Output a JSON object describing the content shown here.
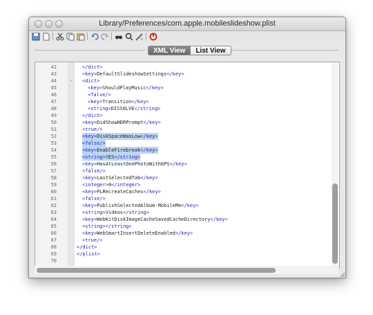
{
  "window": {
    "title": "Library/Preferences/com.apple.mobileslideshow.plist"
  },
  "toolbar": {
    "icons": [
      "save-icon",
      "new-icon",
      "cut-icon",
      "copy-icon",
      "paste-icon",
      "undo-icon",
      "redo-icon",
      "find-icon",
      "find-next-icon",
      "replace-icon",
      "stop-icon"
    ]
  },
  "tabs": {
    "xml": "XML View",
    "list": "List View",
    "selected": "XML View"
  },
  "editor": {
    "fold_marker": "-",
    "lines": [
      {
        "n": "42",
        "indent": 2,
        "parts": [
          [
            "t",
            "</dict>"
          ]
        ]
      },
      {
        "n": "43",
        "indent": 2,
        "parts": [
          [
            "t",
            "<key>"
          ],
          [
            "x",
            "DefaultSlideshowSettings"
          ],
          [
            "t",
            "</key>"
          ]
        ]
      },
      {
        "n": "44",
        "indent": 2,
        "parts": [
          [
            "t",
            "<dict>"
          ]
        ]
      },
      {
        "n": "45",
        "indent": 3,
        "parts": [
          [
            "t",
            "<key>"
          ],
          [
            "x",
            "ShouldPlayMusic"
          ],
          [
            "t",
            "</key>"
          ]
        ]
      },
      {
        "n": "46",
        "indent": 3,
        "parts": [
          [
            "t",
            "<false/>"
          ]
        ]
      },
      {
        "n": "47",
        "indent": 3,
        "parts": [
          [
            "t",
            "<key>"
          ],
          [
            "x",
            "Transition"
          ],
          [
            "t",
            "</key>"
          ]
        ]
      },
      {
        "n": "48",
        "indent": 3,
        "parts": [
          [
            "t",
            "<string>"
          ],
          [
            "x",
            "DISSOLVE"
          ],
          [
            "t",
            "</string>"
          ]
        ]
      },
      {
        "n": "49",
        "indent": 2,
        "parts": [
          [
            "t",
            "</dict>"
          ]
        ]
      },
      {
        "n": "50",
        "indent": 2,
        "parts": [
          [
            "t",
            "<key>"
          ],
          [
            "x",
            "DidShowHDRPrompt"
          ],
          [
            "t",
            "</key>"
          ]
        ]
      },
      {
        "n": "51",
        "indent": 2,
        "parts": [
          [
            "t",
            "<true/>"
          ]
        ]
      },
      {
        "n": "52",
        "indent": 2,
        "parts": [
          [
            "t",
            "<key>"
          ],
          [
            "x",
            "DiskSpaceWasLow"
          ],
          [
            "t",
            "</key>"
          ]
        ]
      },
      {
        "n": "53",
        "indent": 2,
        "parts": [
          [
            "t",
            "<false/>"
          ]
        ]
      },
      {
        "n": "54",
        "indent": 2,
        "parts": [
          [
            "t",
            "<key>"
          ],
          [
            "x",
            "EnableFirebreak"
          ],
          [
            "t",
            "</key>"
          ]
        ]
      },
      {
        "n": "55",
        "indent": 2,
        "parts": [
          [
            "t",
            "<string>"
          ],
          [
            "x",
            "YES"
          ],
          [
            "t",
            "</string>"
          ]
        ]
      },
      {
        "n": "56",
        "indent": 2,
        "parts": [
          [
            "t",
            "<key>"
          ],
          [
            "x",
            "HasAtLeastOnePhotoWithGPS"
          ],
          [
            "t",
            "</key>"
          ]
        ]
      },
      {
        "n": "57",
        "indent": 2,
        "parts": [
          [
            "t",
            "<false/>"
          ]
        ]
      },
      {
        "n": "58",
        "indent": 2,
        "parts": [
          [
            "t",
            "<key>"
          ],
          [
            "x",
            "LastSelectedTab"
          ],
          [
            "t",
            "</key>"
          ]
        ]
      },
      {
        "n": "59",
        "indent": 2,
        "parts": [
          [
            "t",
            "<integer>"
          ],
          [
            "x",
            "0"
          ],
          [
            "t",
            "</integer>"
          ]
        ]
      },
      {
        "n": "60",
        "indent": 2,
        "parts": [
          [
            "t",
            "<key>"
          ],
          [
            "x",
            "PLRecreateCaches"
          ],
          [
            "t",
            "</key>"
          ]
        ]
      },
      {
        "n": "61",
        "indent": 2,
        "parts": [
          [
            "t",
            "<false/>"
          ]
        ]
      },
      {
        "n": "62",
        "indent": 2,
        "parts": [
          [
            "t",
            "<key>"
          ],
          [
            "x",
            "PublishSelectedAlbum-MobileMe"
          ],
          [
            "t",
            "</key>"
          ]
        ]
      },
      {
        "n": "63",
        "indent": 2,
        "parts": [
          [
            "t",
            "<string>"
          ],
          [
            "x",
            "Videos"
          ],
          [
            "t",
            "</string>"
          ]
        ]
      },
      {
        "n": "64",
        "indent": 2,
        "parts": [
          [
            "t",
            "<key>"
          ],
          [
            "x",
            "WebKitDiskImageCacheSavedCacheDirectory"
          ],
          [
            "t",
            "</key>"
          ]
        ]
      },
      {
        "n": "65",
        "indent": 2,
        "parts": [
          [
            "t",
            "<string></string>"
          ]
        ]
      },
      {
        "n": "66",
        "indent": 2,
        "parts": [
          [
            "t",
            "<key>"
          ],
          [
            "x",
            "WebSmartInsertDeleteEnabled"
          ],
          [
            "t",
            "</key>"
          ]
        ]
      },
      {
        "n": "67",
        "indent": 2,
        "parts": [
          [
            "t",
            "<true/>"
          ]
        ]
      },
      {
        "n": "68",
        "indent": 1,
        "parts": [
          [
            "t",
            "</dict>"
          ]
        ]
      },
      {
        "n": "69",
        "indent": 1,
        "parts": [
          [
            "t",
            "</plist>"
          ]
        ]
      },
      {
        "n": "70",
        "indent": 0,
        "parts": []
      }
    ],
    "highlighted_lines": [
      "52",
      "53",
      "54",
      "55"
    ]
  },
  "colors": {
    "tag": "#1f1fb7",
    "text": "#222222",
    "selection": "#bcd5f2",
    "tab_active": "#7a7a7a"
  }
}
